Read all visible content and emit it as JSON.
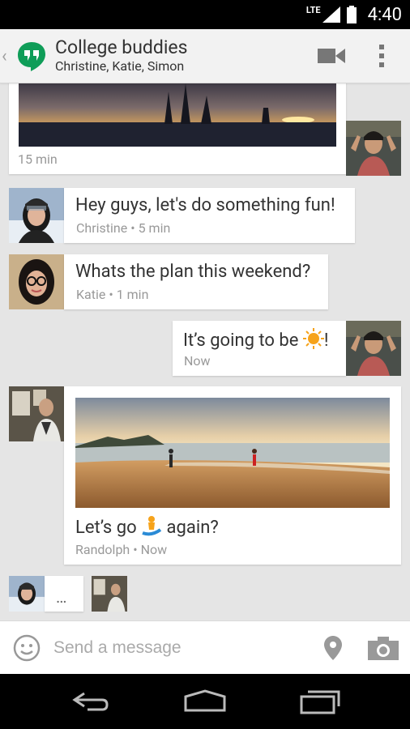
{
  "status_bar": {
    "network": "LTE",
    "time": "4:40"
  },
  "header": {
    "title": "College buddies",
    "subtitle": "Christine, Katie, Simon",
    "video_icon": "video-call-icon",
    "overflow_icon": "overflow-menu-icon"
  },
  "messages": [
    {
      "id": "m1",
      "type": "photo",
      "from": "self",
      "meta": "15 min"
    },
    {
      "id": "m2",
      "text": "Hey guys, let's do something fun!",
      "meta": "Christine • 5 min"
    },
    {
      "id": "m3",
      "text": "Whats the plan this weekend?",
      "meta": "Katie • 1 min"
    },
    {
      "id": "m4",
      "text_before": "It’s going to be ",
      "emoji": "☀️",
      "text_after": "!",
      "meta": "Now"
    },
    {
      "id": "m5",
      "type": "photo",
      "text_before": "Let’s go ",
      "emoji": "🏄",
      "text_after": " again?",
      "meta": "Randolph • Now"
    }
  ],
  "typing": {
    "text": "…"
  },
  "composer": {
    "placeholder": "Send a message"
  },
  "colors": {
    "hangouts_green": "#0f9d58",
    "sun": "#f6a31b"
  }
}
